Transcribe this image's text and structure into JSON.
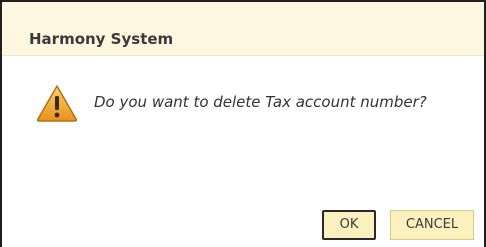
{
  "dialog": {
    "title": "Harmony System",
    "message": "Do you want to delete Tax account number?",
    "icon": "warning-icon"
  },
  "buttons": {
    "ok_label": "OK",
    "cancel_label": "CANCEL"
  },
  "colors": {
    "title_bar_bg": "#fdf7df",
    "button_bg": "#fbf1be",
    "warning_fill": "#f0a531"
  }
}
